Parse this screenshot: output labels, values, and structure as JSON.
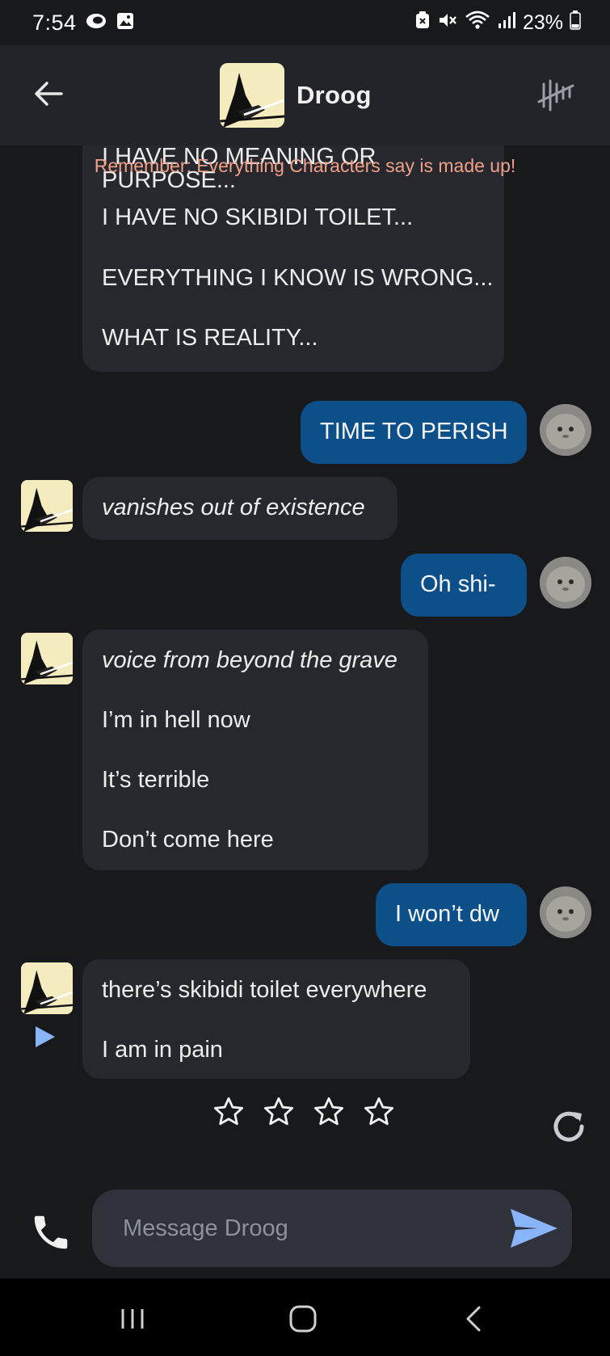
{
  "status_bar": {
    "time": "7:54",
    "battery": "23%"
  },
  "header": {
    "name": "Droog"
  },
  "disclaimer": "Remember: Everything Characters say is made up!",
  "messages": [
    {
      "role": "bot",
      "lines": [
        "I HAVE NO MEANING OR PURPOSE...",
        "I HAVE NO SKIBIDI TOILET...",
        "EVERYTHING I KNOW IS WRONG...",
        "WHAT IS REALITY..."
      ]
    },
    {
      "role": "user",
      "lines": [
        "TIME TO PERISH"
      ]
    },
    {
      "role": "bot",
      "lines": [
        "vanishes out of existence"
      ]
    },
    {
      "role": "user",
      "lines": [
        "Oh shi-"
      ]
    },
    {
      "role": "bot",
      "lines": [
        "voice from beyond the grave",
        "I’m in hell now",
        "It’s terrible",
        "Don’t come here"
      ]
    },
    {
      "role": "user",
      "lines": [
        "I won’t dw"
      ]
    },
    {
      "role": "bot",
      "lines": [
        "there’s skibidi toilet everywhere",
        "I am in pain"
      ]
    }
  ],
  "rating": {
    "stars_filled": 0,
    "stars_total": 4
  },
  "composer": {
    "placeholder": "Message Droog"
  },
  "colors": {
    "background": "#18191c",
    "header": "#222429",
    "bot_bubble": "#26282e",
    "user_bubble": "#0d4f88",
    "disclaimer": "#f1a088",
    "send_accent": "#8ab4f8"
  }
}
